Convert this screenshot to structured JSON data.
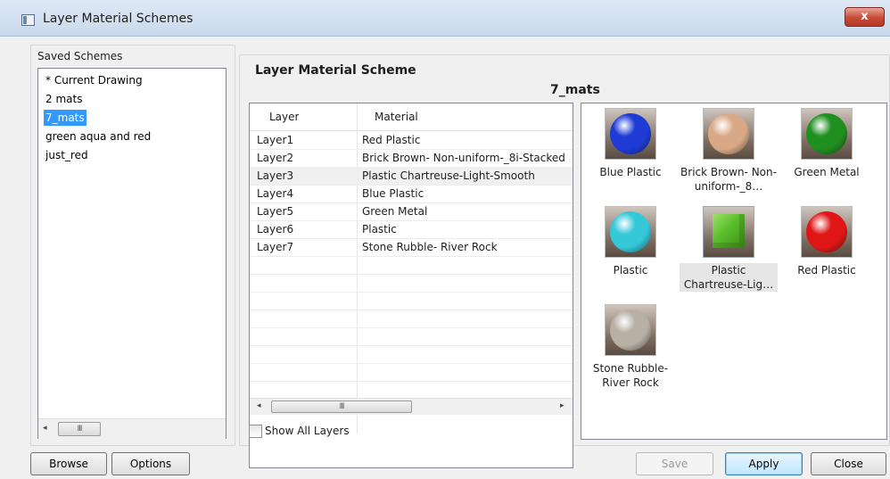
{
  "window": {
    "title": "Layer Material Schemes",
    "close_glyph": "x"
  },
  "saved_schemes": {
    "group_label": "Saved Schemes",
    "items": [
      {
        "label": "* Current Drawing",
        "selected": false
      },
      {
        "label": "2 mats",
        "selected": false
      },
      {
        "label": "7_mats",
        "selected": true
      },
      {
        "label": "green aqua and red",
        "selected": false
      },
      {
        "label": "just_red",
        "selected": false
      }
    ],
    "scroll_left": "◂",
    "scroll_grip": "III"
  },
  "scheme": {
    "group_label": "Layer Material Scheme",
    "name": "7_mats",
    "columns": [
      "Layer",
      "Material"
    ],
    "rows": [
      {
        "layer": "Layer1",
        "material": "Red Plastic",
        "selected": false
      },
      {
        "layer": "Layer2",
        "material": "Brick Brown- Non-uniform-_8i-Stacked",
        "selected": false
      },
      {
        "layer": "Layer3",
        "material": "Plastic Chartreuse-Light-Smooth",
        "selected": true
      },
      {
        "layer": "Layer4",
        "material": "Blue Plastic",
        "selected": false
      },
      {
        "layer": "Layer5",
        "material": "Green Metal",
        "selected": false
      },
      {
        "layer": "Layer6",
        "material": "Plastic",
        "selected": false
      },
      {
        "layer": "Layer7",
        "material": "Stone Rubble- River Rock",
        "selected": false
      }
    ],
    "scroll_left": "◂",
    "scroll_right": "▸",
    "scroll_grip": "III",
    "show_all_layers_label": "Show All Layers",
    "show_all_layers_checked": false
  },
  "swatches": [
    {
      "label": "Blue Plastic",
      "kind": "sphere",
      "color": "#1e3bd6",
      "selected": false
    },
    {
      "label": "Brick Brown- Non-uniform-_8…",
      "kind": "sphere",
      "color": "#d9a987",
      "selected": false
    },
    {
      "label": "Green Metal",
      "kind": "sphere",
      "color": "#1f8f1f",
      "selected": false
    },
    {
      "label": "Plastic",
      "kind": "sphere",
      "color": "#34c8d8",
      "selected": false
    },
    {
      "label": "Plastic Chartreuse-Lig…",
      "kind": "cube",
      "color": "#5bbd2b",
      "selected": true
    },
    {
      "label": "Red Plastic",
      "kind": "sphere",
      "color": "#e01616",
      "selected": false
    },
    {
      "label": "Stone Rubble- River Rock",
      "kind": "sphere",
      "color": "#b8b0a5",
      "selected": false
    }
  ],
  "buttons": {
    "browse": "Browse",
    "options": "Options",
    "save": "Save",
    "apply": "Apply",
    "close": "Close"
  }
}
